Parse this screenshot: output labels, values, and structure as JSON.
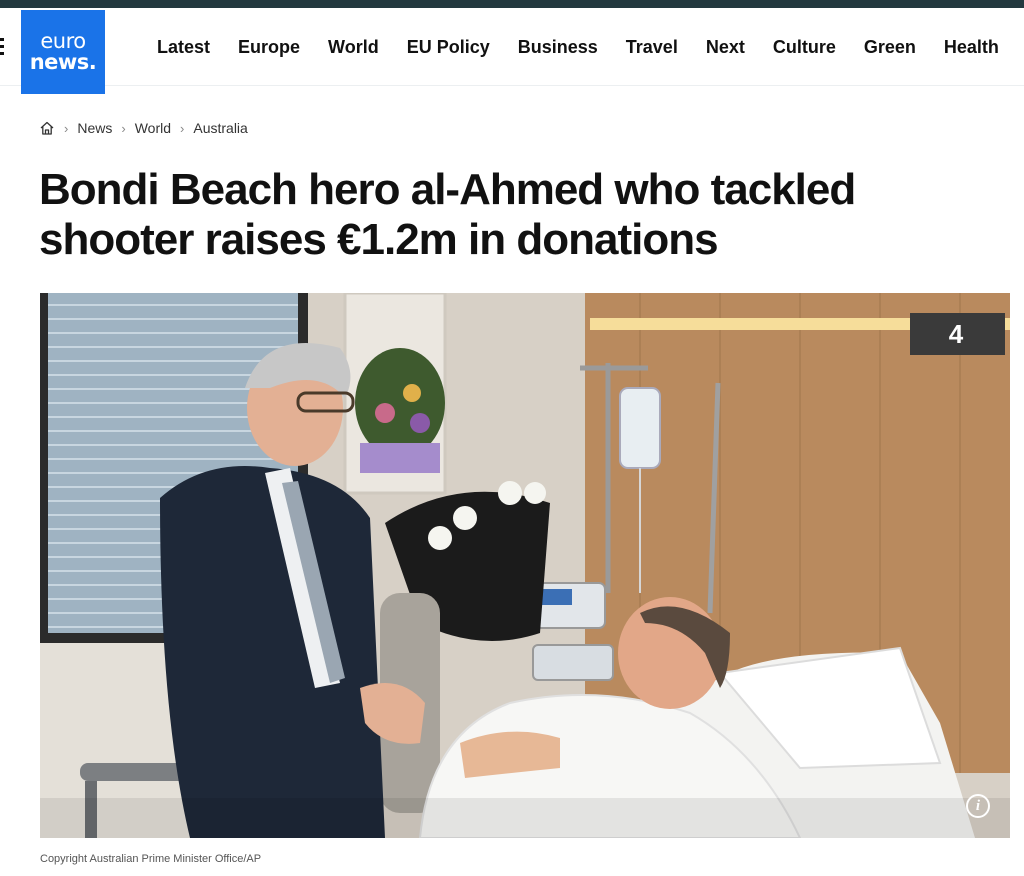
{
  "header": {
    "logo_line1": "euro",
    "logo_line2": "news.",
    "nav": [
      "Latest",
      "Europe",
      "World",
      "EU Policy",
      "Business",
      "Travel",
      "Next",
      "Culture",
      "Green",
      "Health"
    ]
  },
  "breadcrumb": {
    "items": [
      "News",
      "World",
      "Australia"
    ]
  },
  "article": {
    "headline": "Bondi Beach hero al-Ahmed who tackled shooter raises €1.2m in donations",
    "image_caption": "Copyright Australian Prime Minister Office/AP",
    "room_number": "4"
  },
  "colors": {
    "brand_blue": "#1a73e8",
    "top_strip": "#23393f"
  },
  "icons": {
    "menu": "hamburger-icon",
    "home": "home-icon",
    "info": "info-icon"
  }
}
